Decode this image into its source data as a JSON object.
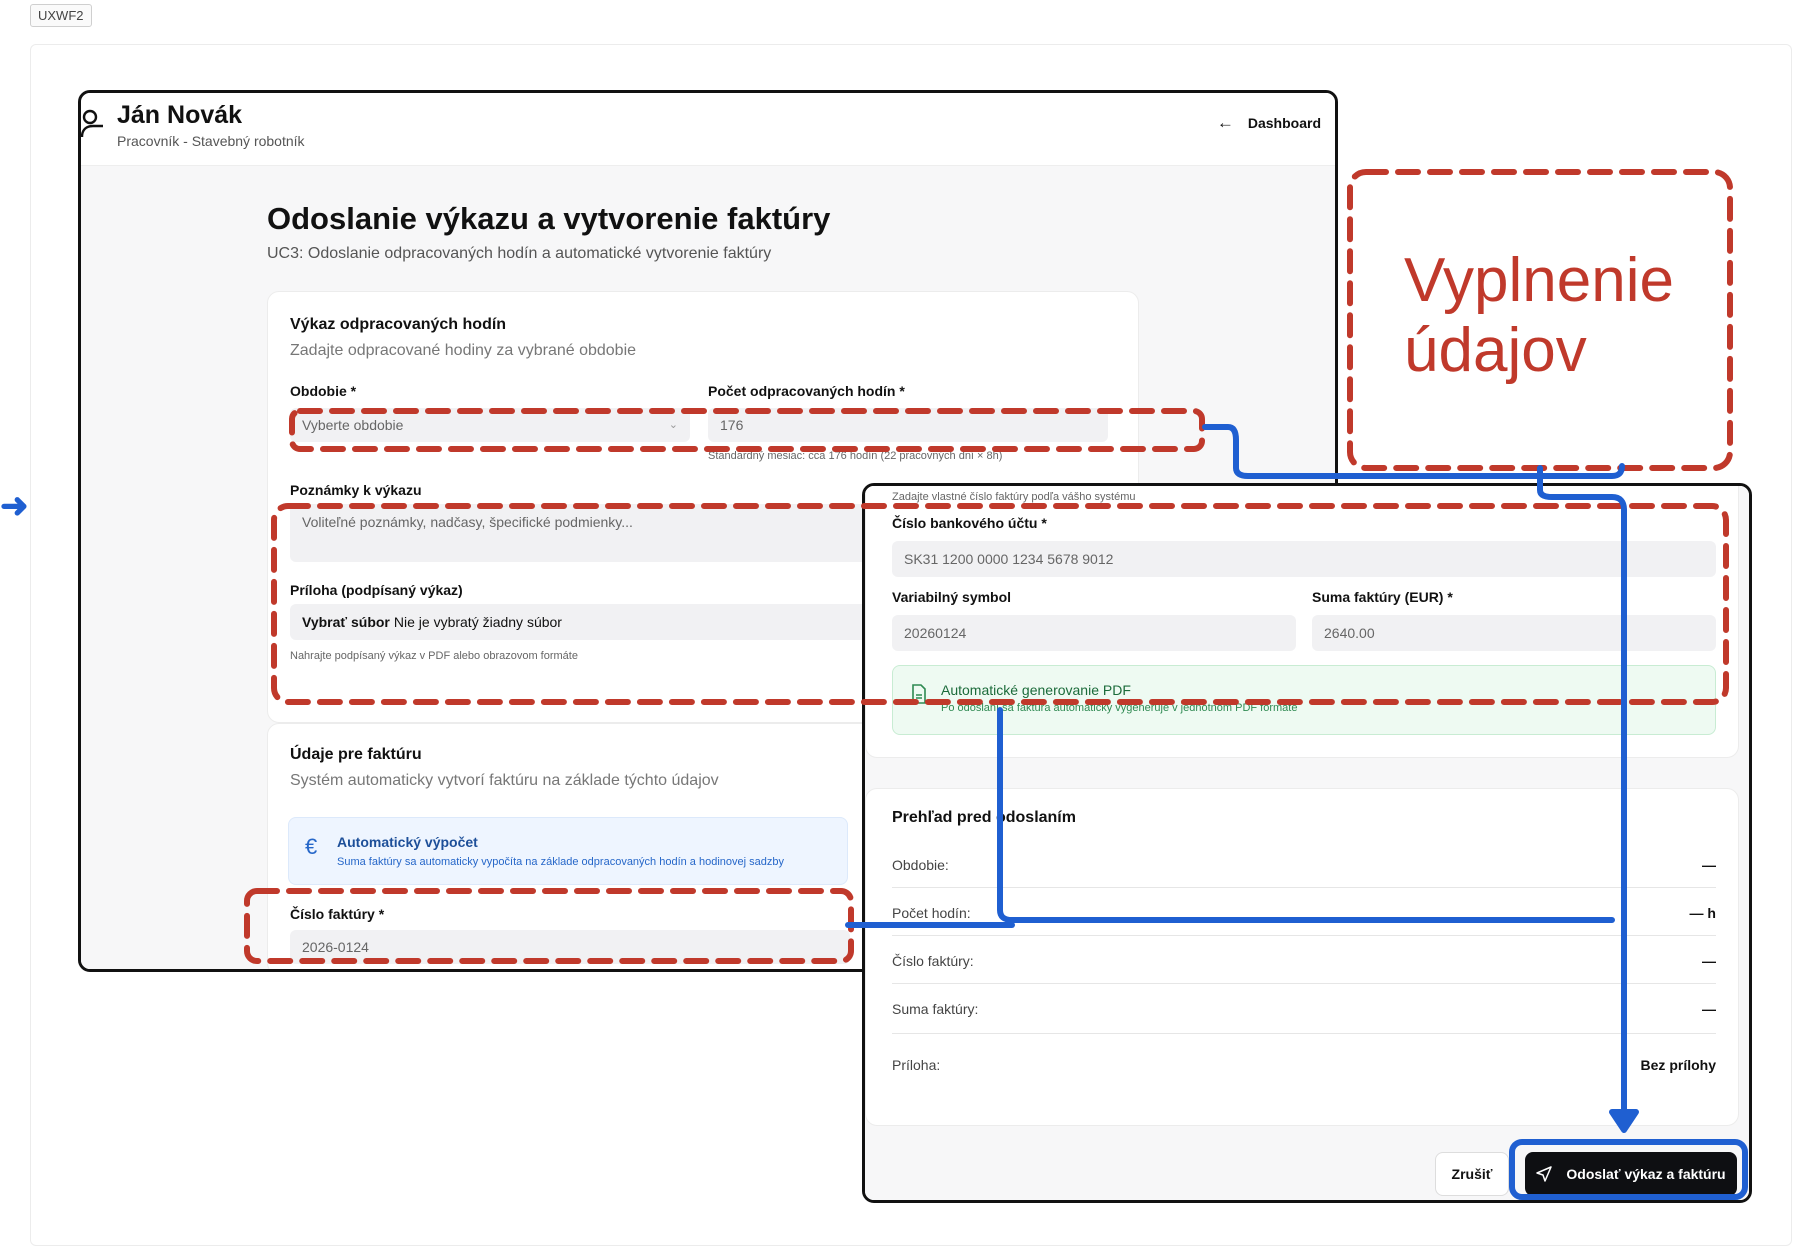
{
  "badge": "UXWF2",
  "screen1": {
    "user_name": "Ján Novák",
    "user_role": "Pracovník - Stavebný robotník",
    "dashboard_link": "Dashboard",
    "page_title": "Odoslanie výkazu a vytvorenie faktúry",
    "page_subtitle": "UC3: Odoslanie odpracovaných hodín a automatické vytvorenie faktúry",
    "timesheet_card": {
      "title": "Výkaz odpracovaných hodín",
      "subtitle": "Zadajte odpracované hodiny za vybrané obdobie",
      "period_label": "Obdobie *",
      "period_placeholder": "Vyberte obdobie",
      "hours_label": "Počet odpracovaných hodín *",
      "hours_value": "176",
      "hours_hint": "Štandardný mesiac: cca 176 hodín (22 pracovných dní × 8h)",
      "notes_label": "Poznámky k výkazu",
      "notes_placeholder": "Voliteľné poznámky, nadčasy, špecifické podmienky...",
      "attachment_label": "Príloha (podpísaný výkaz)",
      "attachment_button": "Vybrať súbor",
      "attachment_status": "Nie je vybratý žiadny súbor",
      "attachment_hint": "Nahrajte podpísaný výkaz v PDF alebo obrazovom formáte"
    },
    "invoice_card": {
      "title": "Údaje pre faktúru",
      "subtitle": "Systém automaticky vytvorí faktúru na základe týchto údajov",
      "auto_calc_title": "Automatický výpočet",
      "auto_calc_desc": "Suma faktúry sa automaticky vypočíta na základe odpracovaných hodín a hodinovej sadzby",
      "auto_calc_icon": "€",
      "invoice_number_label": "Číslo faktúry *",
      "invoice_number_value": "2026-0124"
    }
  },
  "screen2": {
    "invoice_number_hint": "Zadajte vlastné číslo faktúry podľa vášho systému",
    "bank_account_label": "Číslo bankového účtu *",
    "bank_account_value": "SK31 1200 0000 1234 5678 9012",
    "variable_symbol_label": "Variabilný symbol",
    "variable_symbol_value": "20260124",
    "invoice_sum_label": "Suma faktúry (EUR) *",
    "invoice_sum_value": "2640.00",
    "pdf_title": "Automatické generovanie PDF",
    "pdf_desc": "Po odoslaní sa faktúra automaticky vygeneruje v jednotnom PDF formáte",
    "review": {
      "title": "Prehľad pred odoslaním",
      "rows": [
        {
          "label": "Obdobie:",
          "value": "—"
        },
        {
          "label": "Počet hodín:",
          "value": "— h"
        },
        {
          "label": "Číslo faktúry:",
          "value": "—"
        },
        {
          "label": "Suma faktúry:",
          "value": "—"
        },
        {
          "label": "Príloha:",
          "value": "Bez prílohy"
        }
      ]
    },
    "cancel_button": "Zrušiť",
    "submit_button": "Odoslať výkaz a faktúru"
  },
  "callout": {
    "line1": "Vyplnenie",
    "line2": "údajov",
    "color": "#c0392b"
  },
  "colors": {
    "annotation_red": "#c0392b",
    "connector_blue": "#1f5fd1",
    "primary_button": "#0e0f12"
  }
}
